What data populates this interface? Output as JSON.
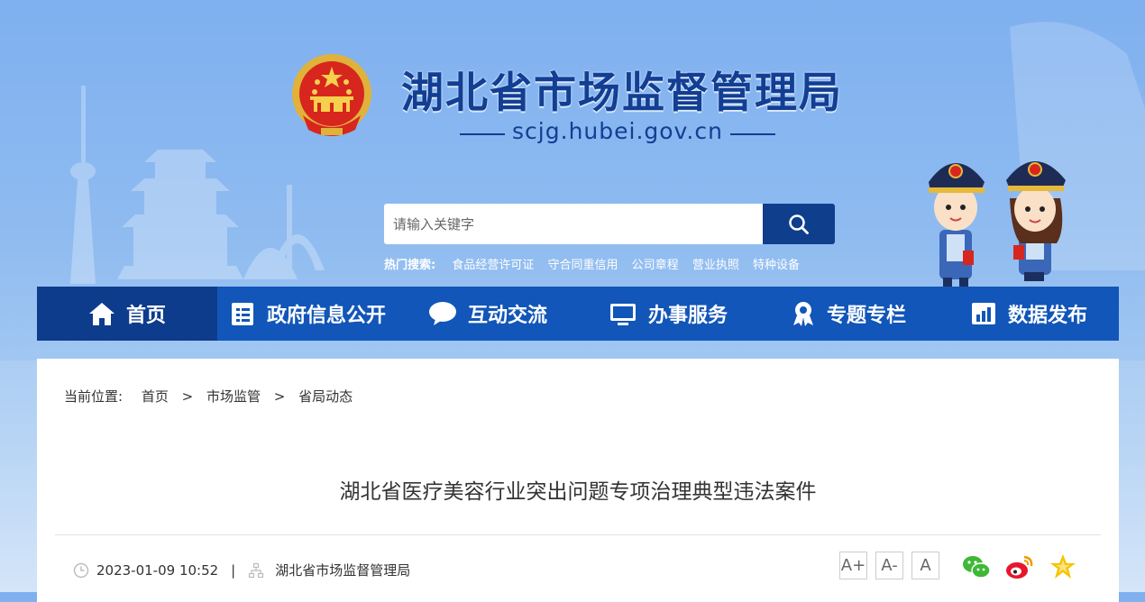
{
  "header": {
    "site_title": "湖北省市场监督管理局",
    "site_domain": "scjg.hubei.gov.cn"
  },
  "search": {
    "placeholder": "请输入关键字",
    "hot_label": "热门搜索:",
    "hot_terms": [
      "食品经营许可证",
      "守合同重信用",
      "公司章程",
      "营业执照",
      "特种设备"
    ]
  },
  "nav": {
    "items": [
      {
        "label": "首页",
        "icon": "home-icon"
      },
      {
        "label": "政府信息公开",
        "icon": "document-list-icon"
      },
      {
        "label": "互动交流",
        "icon": "chat-bubble-icon"
      },
      {
        "label": "办事服务",
        "icon": "monitor-icon"
      },
      {
        "label": "专题专栏",
        "icon": "award-ribbon-icon"
      },
      {
        "label": "数据发布",
        "icon": "bar-chart-icon"
      }
    ]
  },
  "breadcrumb": {
    "label": "当前位置:",
    "items": [
      "首页",
      "市场监管",
      "省局动态"
    ],
    "separator": ">"
  },
  "article": {
    "title": "湖北省医疗美容行业突出问题专项治理典型违法案件",
    "date": "2023-01-09 10:52",
    "source": "湖北省市场监督管理局",
    "font_sizes": [
      "A+",
      "A-",
      "A"
    ],
    "share": [
      "wechat-icon",
      "weibo-icon",
      "favorite-star-icon"
    ]
  },
  "colors": {
    "nav_bg": "#1156b8",
    "nav_active": "#0d3c8c",
    "title": "#123e93",
    "search_btn": "#0f3e8c"
  }
}
